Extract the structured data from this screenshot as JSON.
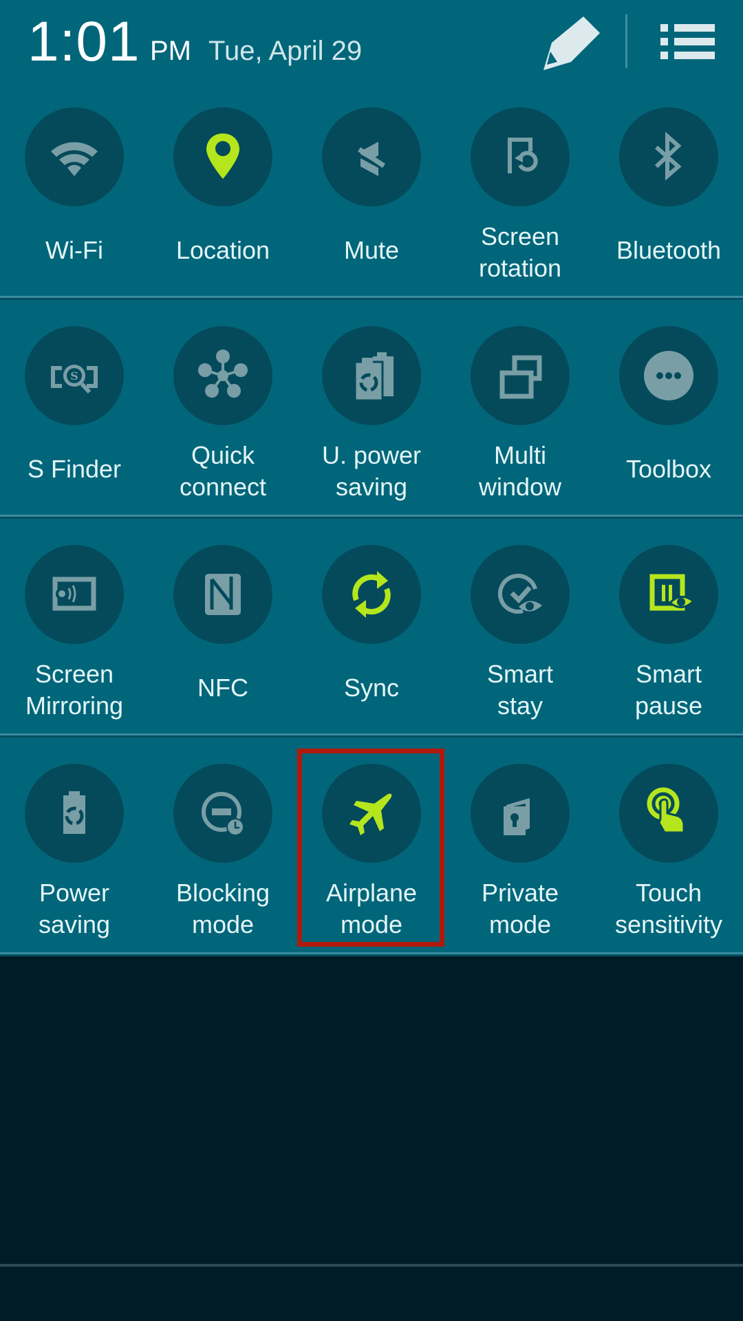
{
  "header": {
    "time": "1:01",
    "ampm": "PM",
    "date": "Tue, April 29",
    "edit_icon": "pencil-icon",
    "list_icon": "list-icon"
  },
  "colors": {
    "panel_bg": "#02667a",
    "circle_bg": "#044a5b",
    "icon_off": "#7a9ea6",
    "icon_on": "#b5e61d",
    "highlight": "#b01a0c",
    "screen_bg": "#021c27"
  },
  "tiles": [
    {
      "label": "Wi-Fi",
      "icon": "wifi-icon",
      "active": false
    },
    {
      "label": "Location",
      "icon": "location-pin-icon",
      "active": true
    },
    {
      "label": "Mute",
      "icon": "mute-icon",
      "active": false
    },
    {
      "label": "Screen\nrotation",
      "icon": "screen-rotation-icon",
      "active": false
    },
    {
      "label": "Bluetooth",
      "icon": "bluetooth-icon",
      "active": false
    },
    {
      "label": "S Finder",
      "icon": "s-finder-icon",
      "active": false
    },
    {
      "label": "Quick\nconnect",
      "icon": "quick-connect-icon",
      "active": false
    },
    {
      "label": "U. power\nsaving",
      "icon": "ultra-power-saving-icon",
      "active": false
    },
    {
      "label": "Multi\nwindow",
      "icon": "multi-window-icon",
      "active": false
    },
    {
      "label": "Toolbox",
      "icon": "toolbox-icon",
      "active": false
    },
    {
      "label": "Screen\nMirroring",
      "icon": "screen-mirroring-icon",
      "active": false
    },
    {
      "label": "NFC",
      "icon": "nfc-icon",
      "active": false
    },
    {
      "label": "Sync",
      "icon": "sync-icon",
      "active": true
    },
    {
      "label": "Smart\nstay",
      "icon": "smart-stay-icon",
      "active": false
    },
    {
      "label": "Smart\npause",
      "icon": "smart-pause-icon",
      "active": true
    },
    {
      "label": "Power\nsaving",
      "icon": "power-saving-icon",
      "active": false
    },
    {
      "label": "Blocking\nmode",
      "icon": "blocking-mode-icon",
      "active": false
    },
    {
      "label": "Airplane\nmode",
      "icon": "airplane-icon",
      "active": true,
      "highlighted": true
    },
    {
      "label": "Private\nmode",
      "icon": "private-mode-icon",
      "active": false
    },
    {
      "label": "Touch\nsensitivity",
      "icon": "touch-sensitivity-icon",
      "active": true
    }
  ]
}
